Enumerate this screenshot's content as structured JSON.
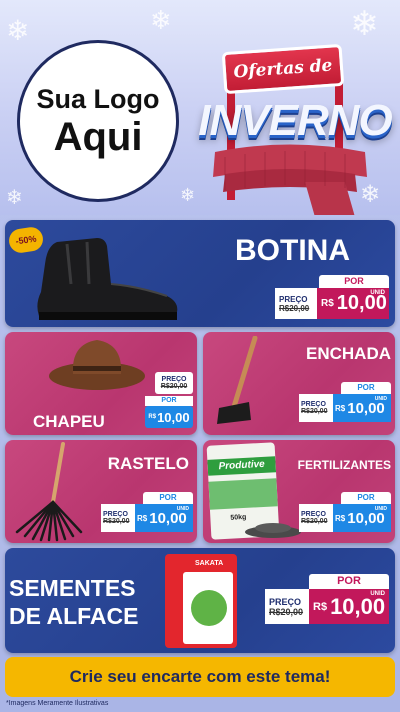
{
  "header": {
    "logo_line1": "Sua Logo",
    "logo_line2": "Aqui",
    "sign_text": "Ofertas de",
    "winter_text": "INVERNO"
  },
  "products": {
    "botina": {
      "name": "BOTINA",
      "discount": "-50%",
      "preco_label": "PREÇO",
      "old_price": "R$20,00",
      "por_label": "POR",
      "currency": "R$",
      "price": "10,00",
      "unit": "UNID"
    },
    "chapeu": {
      "name": "CHAPEU",
      "preco_label": "PREÇO",
      "old_price": "R$20,00",
      "por_label": "POR",
      "currency": "R$",
      "price": "10,00",
      "unit": "UNID"
    },
    "enchada": {
      "name": "ENCHADA",
      "preco_label": "PREÇO",
      "old_price": "R$20,00",
      "por_label": "POR",
      "currency": "R$",
      "price": "10,00",
      "unit": "UNID"
    },
    "rastelo": {
      "name": "RASTELO",
      "preco_label": "PREÇO",
      "old_price": "R$20,00",
      "por_label": "POR",
      "currency": "R$",
      "price": "10,00",
      "unit": "UNID"
    },
    "fertilizantes": {
      "name": "FERTILIZANTES",
      "bag_brand": "Produtive",
      "bag_weight": "50kg",
      "preco_label": "PREÇO",
      "old_price": "R$20,00",
      "por_label": "POR",
      "currency": "R$",
      "price": "10,00",
      "unit": "UNID"
    },
    "sementes": {
      "name_line1": "SEMENTES",
      "name_line2": "DE ALFACE",
      "pack_brand": "SAKATA",
      "preco_label": "PREÇO",
      "old_price": "R$20,00",
      "por_label": "POR",
      "currency": "R$",
      "price": "10,00",
      "unit": "UNID"
    }
  },
  "footer": {
    "cta": "Crie seu encarte com este tema!",
    "disclaimer": "*Imagens Meramente Ilustrativas"
  },
  "colors": {
    "blue_panel": "#2d4a9c",
    "pink_panel": "#c8487e",
    "yellow": "#f5b700",
    "magenta": "#c2185b",
    "price_blue": "#1e88e5"
  }
}
